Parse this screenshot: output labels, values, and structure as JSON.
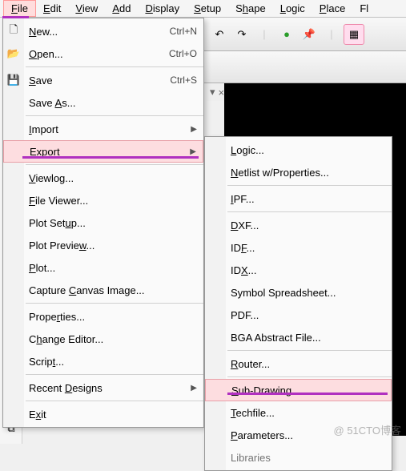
{
  "menubar": {
    "file": "File",
    "edit": "Edit",
    "view": "View",
    "add": "Add",
    "display": "Display",
    "setup": "Setup",
    "shape": "Shape",
    "logic": "Logic",
    "place": "Place",
    "fl": "Fl"
  },
  "file_menu": {
    "new": "New...",
    "open": "Open...",
    "save": "Save",
    "save_as": "Save As...",
    "import": "Import",
    "export": "Export",
    "viewlog": "Viewlog...",
    "file_viewer": "File Viewer...",
    "plot_setup": "Plot Setup...",
    "plot_preview": "Plot Preview...",
    "plot": "Plot...",
    "capture_canvas": "Capture Canvas Image...",
    "properties": "Properties...",
    "change_editor": "Change Editor...",
    "script": "Script...",
    "recent_designs": "Recent Designs",
    "exit": "Exit",
    "sc_new": "Ctrl+N",
    "sc_open": "Ctrl+O",
    "sc_save": "Ctrl+S"
  },
  "export_submenu": {
    "logic": "Logic...",
    "netlist": "Netlist w/Properties...",
    "ipf": "IPF...",
    "dxf": "DXF...",
    "idf": "IDF...",
    "idx": "IDX...",
    "symbol_spreadsheet": "Symbol Spreadsheet...",
    "pdf": "PDF...",
    "bga_abstract": "BGA Abstract File...",
    "router": "Router...",
    "sub_drawing": "Sub-Drawing",
    "techfile": "Techfile...",
    "parameters": "Parameters...",
    "libraries": "Libraries"
  },
  "watermark": "@ 51CTO博客"
}
